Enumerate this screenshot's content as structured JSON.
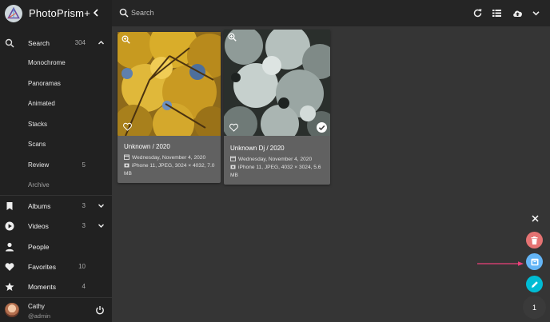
{
  "app": {
    "title": "PhotoPrism+"
  },
  "sidebar": {
    "items": [
      {
        "label": "Search",
        "count": "304",
        "icon": "search-icon"
      },
      {
        "label": "Monochrome",
        "count": ""
      },
      {
        "label": "Panoramas",
        "count": ""
      },
      {
        "label": "Animated",
        "count": ""
      },
      {
        "label": "Stacks",
        "count": ""
      },
      {
        "label": "Scans",
        "count": ""
      },
      {
        "label": "Review",
        "count": "5"
      },
      {
        "label": "Archive",
        "count": ""
      },
      {
        "label": "Albums",
        "count": "3",
        "icon": "bookmark-icon"
      },
      {
        "label": "Videos",
        "count": "3",
        "icon": "play-circle-icon"
      },
      {
        "label": "People",
        "count": "",
        "icon": "person-icon"
      },
      {
        "label": "Favorites",
        "count": "10",
        "icon": "heart-icon"
      },
      {
        "label": "Moments",
        "count": "4",
        "icon": "star-icon"
      }
    ],
    "user": {
      "name": "Cathy",
      "handle": "@admin"
    }
  },
  "search": {
    "placeholder": "Search"
  },
  "toolbar": {
    "icons": [
      "refresh-icon",
      "list-view-icon",
      "upload-icon",
      "chevron-down-icon"
    ]
  },
  "photos": [
    {
      "title": "Unknown / 2020",
      "date": "Wednesday, November 4, 2020",
      "info": "iPhone 11, JPEG, 3024 × 4032, 7.0 MB",
      "selected": false
    },
    {
      "title": "Unknown Dj / 2020",
      "date": "Wednesday, November 4, 2020",
      "info": "iPhone 11, JPEG, 4032 × 3024, 5.6 MB",
      "selected": true
    }
  ],
  "speed_dial": {
    "colors": {
      "delete": "#e57373",
      "archive": "#64b5f6",
      "edit": "#00bcd4",
      "count": "#3a3a3a"
    },
    "count": "1"
  },
  "colors": {
    "annotation_arrow": "#ec407a"
  }
}
